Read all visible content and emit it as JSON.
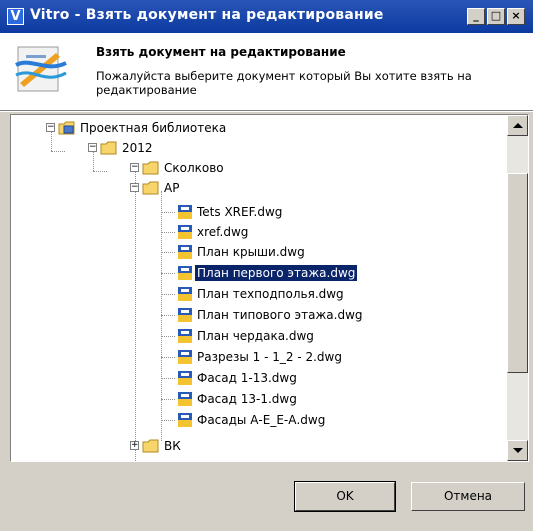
{
  "window": {
    "title": "Vitro - Взять документ на редактирование",
    "app_icon_letter": "V",
    "title_buttons": {
      "minimize": "_",
      "maximize": "□",
      "close": "×"
    }
  },
  "header": {
    "title": "Взять документ на редактирование",
    "description": "Пожалуйста выберите документ который Вы хотите взять на редактирование"
  },
  "tree": {
    "nodes": [
      {
        "label": "Проектная библиотека",
        "kind": "library",
        "expanded": true
      },
      {
        "label": "2012",
        "kind": "folder",
        "expanded": true
      },
      {
        "label": "Сколково",
        "kind": "folder",
        "expanded": true
      },
      {
        "label": "АР",
        "kind": "folder",
        "expanded": true
      },
      {
        "label": "Tets XREF.dwg",
        "kind": "file"
      },
      {
        "label": "xref.dwg",
        "kind": "file"
      },
      {
        "label": "План крыши.dwg",
        "kind": "file"
      },
      {
        "label": "План первого этажа.dwg",
        "kind": "file",
        "selected": true
      },
      {
        "label": "План техподполья.dwg",
        "kind": "file"
      },
      {
        "label": "План типового этажа.dwg",
        "kind": "file"
      },
      {
        "label": "План чердака.dwg",
        "kind": "file"
      },
      {
        "label": "Разрезы 1 - 1_2 - 2.dwg",
        "kind": "file"
      },
      {
        "label": "Фасад 1-13.dwg",
        "kind": "file"
      },
      {
        "label": "Фасад 13-1.dwg",
        "kind": "file"
      },
      {
        "label": "Фасады А-Е_Е-А.dwg",
        "kind": "file"
      },
      {
        "label": "ВК",
        "kind": "folder",
        "expanded": false
      }
    ]
  },
  "buttons": {
    "ok": "OK",
    "cancel": "Отмена"
  },
  "colors": {
    "titlebar": "#0c3aa0",
    "selection": "#0a246a",
    "dialog": "#d4d0c8",
    "folder": "#f7d56b"
  }
}
